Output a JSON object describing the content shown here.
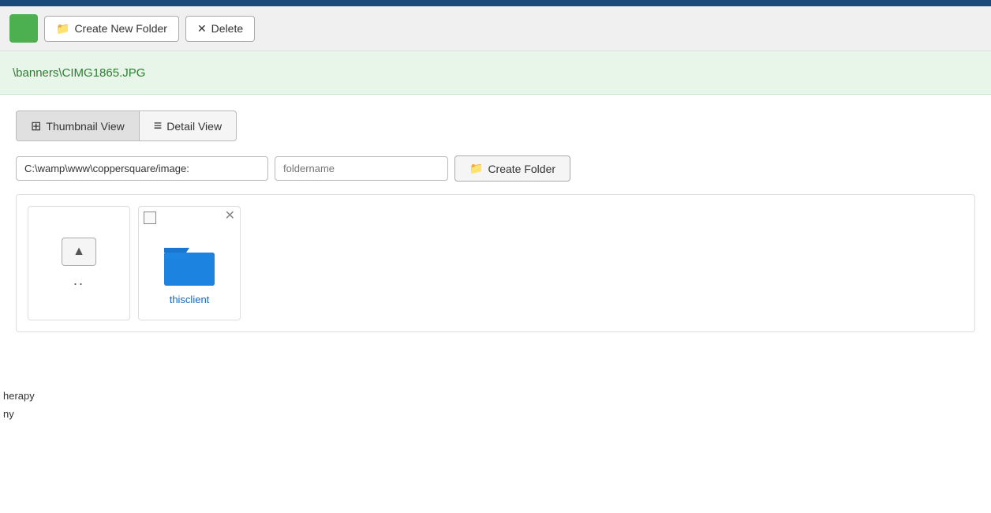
{
  "topbar": {
    "color": "#1a4a7a"
  },
  "toolbar": {
    "green_btn_label": "",
    "create_new_folder_label": "Create New Folder",
    "delete_label": "Delete"
  },
  "path_bar": {
    "path": "\\banners\\CIMG1865.JPG"
  },
  "view_toggle": {
    "thumbnail_label": "Thumbnail View",
    "detail_label": "Detail View"
  },
  "create_folder_row": {
    "path_value": "C:\\wamp\\www\\coppersquare/image:",
    "folder_name_placeholder": "foldername",
    "create_folder_label": "Create Folder"
  },
  "file_browser": {
    "items": [
      {
        "type": "parent",
        "label": ".."
      },
      {
        "type": "folder",
        "name": "thisclient"
      }
    ]
  },
  "sidebar": {
    "line1": "herapy",
    "line2": "ny"
  }
}
